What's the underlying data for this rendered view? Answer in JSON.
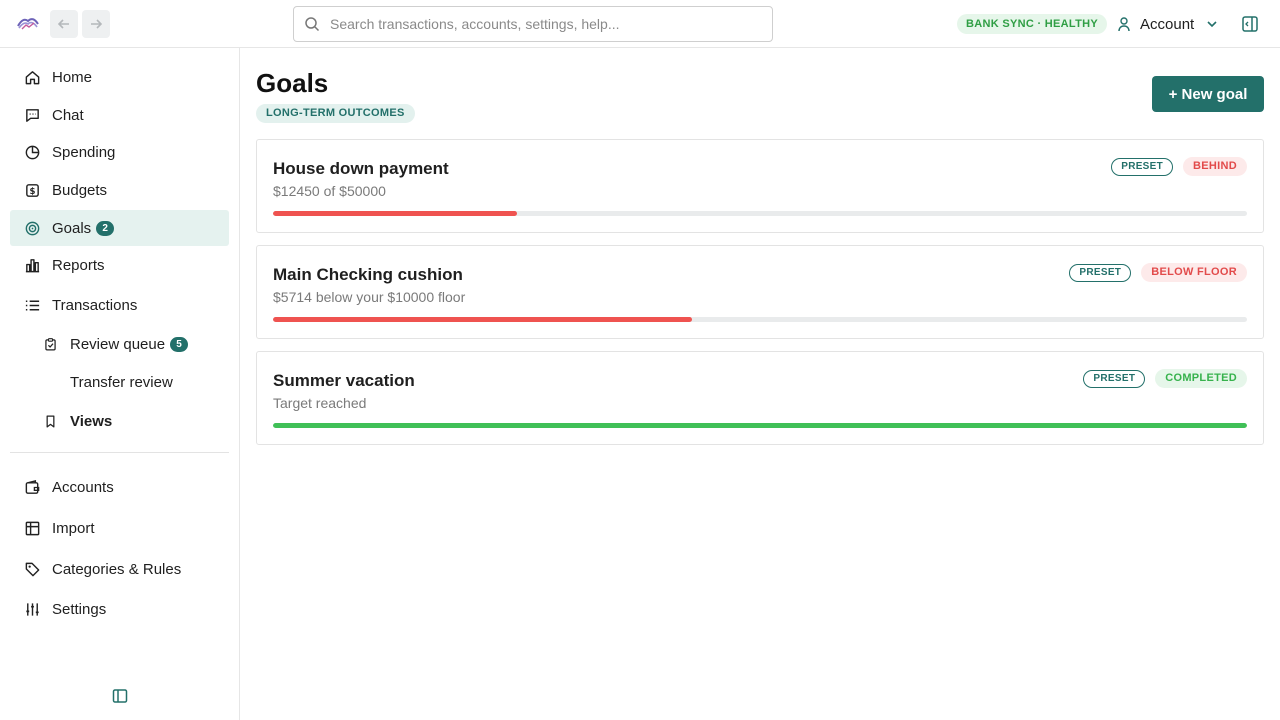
{
  "app": {
    "logo_icon": "app-logo-icon",
    "back_icon": "arrow-left-icon",
    "forward_icon": "arrow-right-icon"
  },
  "search": {
    "placeholder": "Search transactions, accounts, settings, help..."
  },
  "status": {
    "sync_label": "BANK SYNC · HEALTHY",
    "color": "#2f9e44"
  },
  "account": {
    "label": "Account"
  },
  "sidebar": {
    "items": [
      {
        "label": "Home",
        "icon": "home-icon"
      },
      {
        "label": "Chat",
        "icon": "chat-icon"
      },
      {
        "label": "Spending",
        "icon": "pie-chart-icon"
      },
      {
        "label": "Budgets",
        "icon": "budget-icon"
      },
      {
        "label": "Goals",
        "icon": "target-icon",
        "count": "2",
        "active": true
      },
      {
        "label": "Reports",
        "icon": "bar-chart-icon"
      },
      {
        "label": "Transactions",
        "icon": "list-icon"
      },
      {
        "label": "Review queue",
        "icon": "clipboard-check-icon",
        "count": "5"
      },
      {
        "label": "Transfer review"
      },
      {
        "label": "Views",
        "icon": "bookmark-icon"
      }
    ],
    "bottom_items": [
      {
        "label": "Accounts",
        "icon": "wallet-icon"
      },
      {
        "label": "Import",
        "icon": "import-icon"
      },
      {
        "label": "Categories & Rules",
        "icon": "tag-icon"
      },
      {
        "label": "Settings",
        "icon": "sliders-icon"
      }
    ]
  },
  "page": {
    "title": "Goals",
    "tag": "LONG-TERM OUTCOMES",
    "new_goal_label": "+ New goal"
  },
  "goals": [
    {
      "name": "House down payment",
      "subtitle": "$12450 of $50000",
      "preset": "PRESET",
      "status": "BEHIND",
      "progress": 0.25,
      "color": "#ef5350"
    },
    {
      "name": "Main Checking cushion",
      "subtitle": "$5714 below your $10000 floor",
      "preset": "PRESET",
      "status": "BELOW FLOOR",
      "progress": 0.43,
      "color": "#ef5350"
    },
    {
      "name": "Summer vacation",
      "subtitle": "Target reached",
      "preset": "PRESET",
      "status": "COMPLETED",
      "progress": 1.0,
      "color": "#40c057"
    }
  ],
  "colors": {
    "accent": "#23706a",
    "danger": "#e24b4b",
    "success": "#37b24d"
  }
}
